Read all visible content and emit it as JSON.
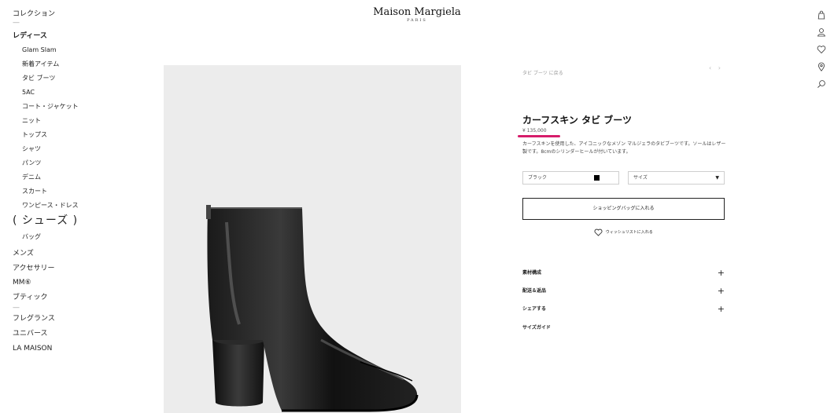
{
  "brand": {
    "name": "Maison Margiela",
    "sub": "PARIS"
  },
  "sidebar": {
    "collection": "コレクション",
    "separator": "—",
    "ladies": "レディース",
    "ladies_items": [
      "Glam Slam",
      "新着アイテム",
      "タビ ブーツ",
      "5AC",
      "コート・ジャケット",
      "ニット",
      "トップス",
      "シャツ",
      "パンツ",
      "デニム",
      "スカート",
      "ワンピース・ドレス"
    ],
    "current": "( シューズ )",
    "bag": "バッグ",
    "mens": "メンズ",
    "accessories": "アクセサリー",
    "mm6": "MM⑥",
    "boutique": "ブティック",
    "fragrance": "フレグランス",
    "universe": "ユニバース",
    "la_maison": "LA MAISON"
  },
  "icons": {
    "shopping_bag": "shopping-bag-icon",
    "account": "account-icon",
    "wishlist": "heart-icon",
    "store_locator": "location-pin-icon",
    "search": "search-icon"
  },
  "product": {
    "breadcrumb": "タビ ブーツ に戻る",
    "prev": "‹",
    "next": "›",
    "title": "カーフスキン タビ ブーツ",
    "price": "¥ 135,000",
    "description": "カーフスキンを使用した、アイコニックなメゾン マルジェラのタビブーツです。ソールはレザー製です。8cmのシリンダーヒールが付いています。",
    "color": {
      "label": "ブラック",
      "swatch": "#000000"
    },
    "size": {
      "label": "サイズ"
    },
    "add_to_bag": "ショッピングバッグに入れる",
    "wishlist": "ウィッシュリストに入れる",
    "accordions": [
      {
        "label": "素材構成",
        "icon": "+"
      },
      {
        "label": "配送＆返品",
        "icon": "+"
      },
      {
        "label": "シェアする",
        "icon": "+"
      },
      {
        "label": "サイズガイド",
        "icon": ""
      }
    ]
  },
  "colors": {
    "accent_underline": "#d61d6b",
    "image_background": "#ececec"
  }
}
